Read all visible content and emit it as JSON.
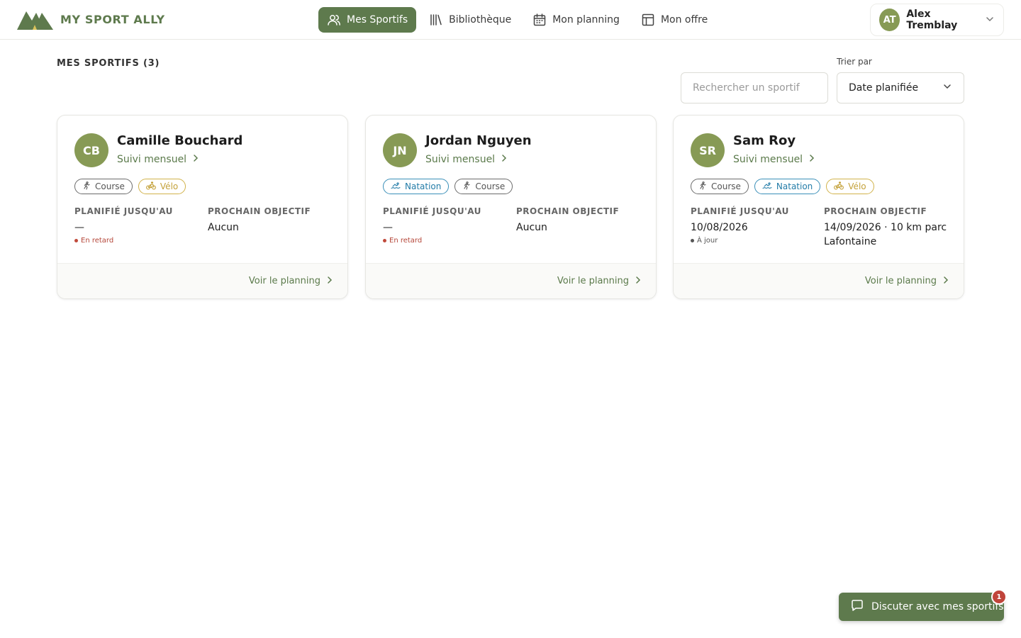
{
  "brand": {
    "name": "MY SPORT ALLY",
    "logo_icon": "mountain-logo-icon"
  },
  "nav": {
    "items": [
      {
        "label": "Mes Sportifs",
        "icon": "users-icon",
        "active": true
      },
      {
        "label": "Bibliothèque",
        "icon": "library-icon",
        "active": false
      },
      {
        "label": "Mon planning",
        "icon": "calendar-icon",
        "active": false
      },
      {
        "label": "Mon offre",
        "icon": "layout-icon",
        "active": false
      }
    ]
  },
  "user": {
    "initials": "AT",
    "name": "Alex Tremblay"
  },
  "page": {
    "title": "MES SPORTIFS (3)",
    "search_placeholder": "Rechercher un sportif",
    "sort_label": "Trier par",
    "sort_value": "Date planifiée"
  },
  "athletes": [
    {
      "initials": "CB",
      "name": "Camille Bouchard",
      "plan": "Suivi mensuel",
      "tags": [
        "Course",
        "Vélo"
      ],
      "planned_label": "PLANIFIÉ JUSQU'AU",
      "planned_value": "—",
      "status": "En retard",
      "goal_label": "PROCHAIN OBJECTIF",
      "goal_value": "Aucun",
      "footer_link": "Voir le planning"
    },
    {
      "initials": "JN",
      "name": "Jordan Nguyen",
      "plan": "Suivi mensuel",
      "tags": [
        "Natation",
        "Course"
      ],
      "planned_label": "PLANIFIÉ JUSQU'AU",
      "planned_value": "—",
      "status": "En retard",
      "goal_label": "PROCHAIN OBJECTIF",
      "goal_value": "Aucun",
      "footer_link": "Voir le planning"
    },
    {
      "initials": "SR",
      "name": "Sam Roy",
      "plan": "Suivi mensuel",
      "tags": [
        "Course",
        "Natation",
        "Vélo"
      ],
      "planned_label": "PLANIFIÉ JUSQU'AU",
      "planned_value": "10/08/2026",
      "status": "À jour",
      "goal_label": "PROCHAIN OBJECTIF",
      "goal_value": "14/09/2026 · 10 km parc Lafontaine",
      "footer_link": "Voir le planning"
    }
  ],
  "chat": {
    "label": "Discuter avec mes sportifs",
    "badge": "1"
  },
  "colors": {
    "primary": "#5e7a4d",
    "avatar": "#879a55",
    "late": "#c0493a",
    "swim": "#237ca8",
    "bike": "#c4a23b"
  }
}
